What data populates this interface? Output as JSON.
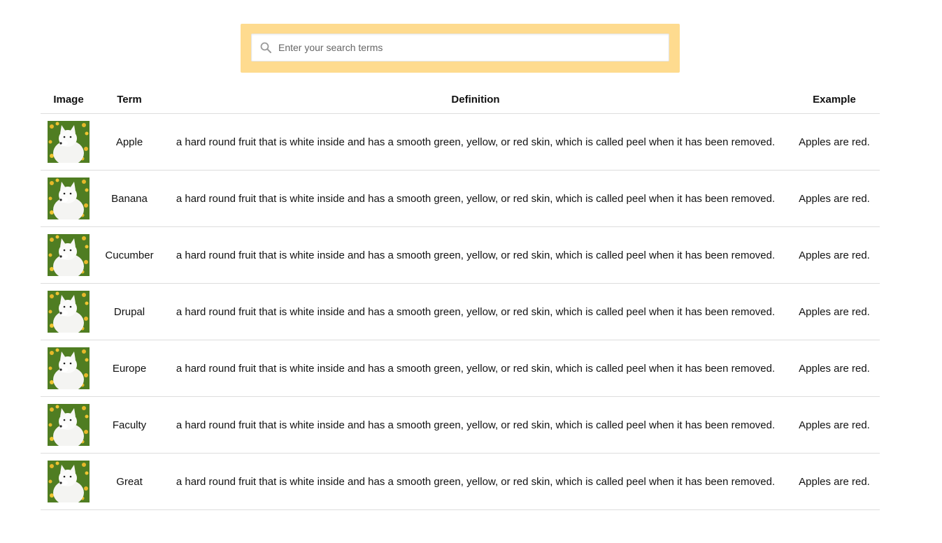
{
  "search": {
    "placeholder": "Enter your search terms",
    "value": "",
    "panel_color": "#fedb8f"
  },
  "table": {
    "headers": {
      "image": "Image",
      "term": "Term",
      "definition": "Definition",
      "example": "Example"
    },
    "rows": [
      {
        "image": "dog-photo",
        "term": "Apple",
        "definition": "a hard round fruit that is white inside and has a smooth green, yellow, or red skin, which is called peel when it has been removed.",
        "example": "Apples are red."
      },
      {
        "image": "dog-photo",
        "term": "Banana",
        "definition": "a hard round fruit that is white inside and has a smooth green, yellow, or red skin, which is called peel when it has been removed.",
        "example": "Apples are red."
      },
      {
        "image": "dog-photo",
        "term": "Cucumber",
        "definition": "a hard round fruit that is white inside and has a smooth green, yellow, or red skin, which is called peel when it has been removed.",
        "example": "Apples are red."
      },
      {
        "image": "dog-photo",
        "term": "Drupal",
        "definition": "a hard round fruit that is white inside and has a smooth green, yellow, or red skin, which is called peel when it has been removed.",
        "example": "Apples are red."
      },
      {
        "image": "dog-photo",
        "term": "Europe",
        "definition": "a hard round fruit that is white inside and has a smooth green, yellow, or red skin, which is called peel when it has been removed.",
        "example": "Apples are red."
      },
      {
        "image": "dog-photo",
        "term": "Faculty",
        "definition": "a hard round fruit that is white inside and has a smooth green, yellow, or red skin, which is called peel when it has been removed.",
        "example": "Apples are red."
      },
      {
        "image": "dog-photo",
        "term": "Great",
        "definition": "a hard round fruit that is white inside and has a smooth green, yellow, or red skin, which is called peel when it has been removed.",
        "example": "Apples are red."
      }
    ]
  },
  "colors": {
    "row_border": "#dddddd",
    "text": "#111111"
  }
}
